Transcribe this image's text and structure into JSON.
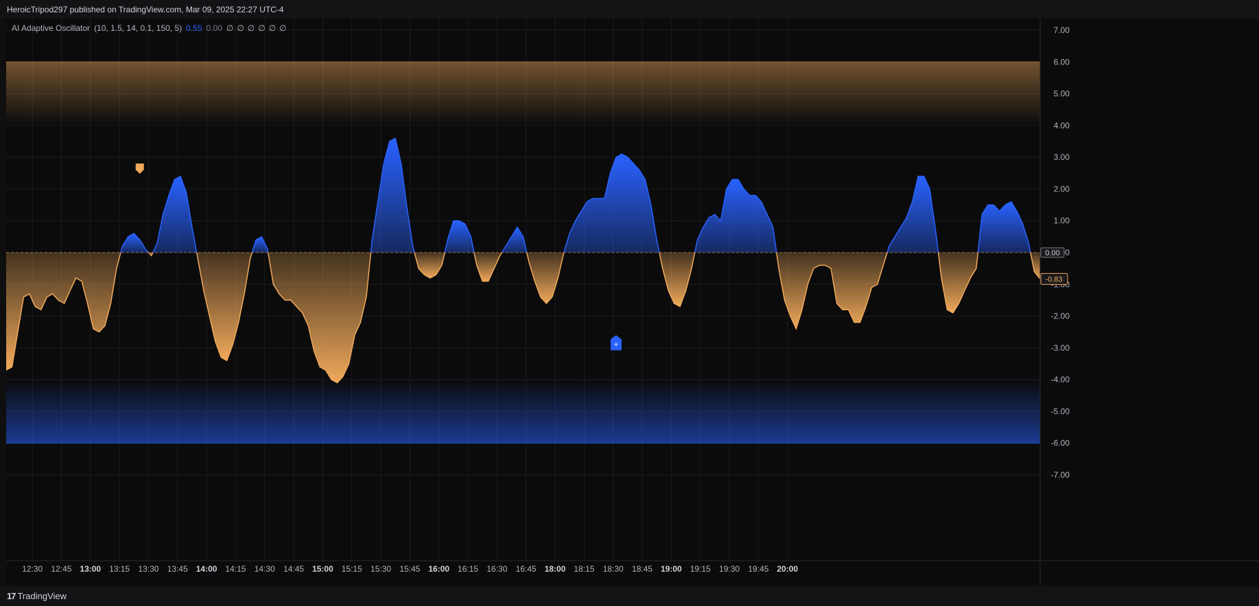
{
  "header": {
    "publisher": "HeroicTripod297 published on TradingView.com, Mar 09, 2025 22:27 UTC-4"
  },
  "legend": {
    "indicator": "AI Adaptive Oscillator",
    "params": "(10, 1.5, 14, 0.1, 150, 5)",
    "value_main": "0.55",
    "value_zero": "0.00",
    "empties": [
      "∅",
      "∅",
      "∅",
      "∅",
      "∅",
      "∅"
    ]
  },
  "footer": {
    "brand_mark": "17",
    "brand_name": "TradingView"
  },
  "colors": {
    "bull": "#2962ff",
    "bear": "#f0a95a",
    "bg": "#0b0b0c",
    "grid": "#1c1c1f",
    "text": "#b2b5be"
  },
  "chart_data": {
    "type": "area",
    "title": "",
    "ylim": [
      -7.0,
      7.0
    ],
    "yticks": [
      "7.00",
      "6.00",
      "5.00",
      "4.00",
      "3.00",
      "2.00",
      "1.00",
      "0.00",
      "-1.00",
      "-2.00",
      "-3.00",
      "-4.00",
      "-5.00",
      "-6.00",
      "-7.00"
    ],
    "ytick_values": [
      7,
      6,
      5,
      4,
      3,
      2,
      1,
      0,
      -1,
      -2,
      -3,
      -4,
      -5,
      -6,
      -7
    ],
    "xtick_labels": [
      "12:30",
      "12:45",
      "13:00",
      "13:15",
      "13:30",
      "13:45",
      "14:00",
      "14:15",
      "14:30",
      "14:45",
      "15:00",
      "15:15",
      "15:30",
      "15:45",
      "16:00",
      "16:15",
      "16:30",
      "16:45",
      "18:00",
      "18:15",
      "18:30",
      "18:45",
      "19:00",
      "19:15",
      "19:30",
      "19:45",
      "20:00"
    ],
    "xtick_bold": [
      "13:00",
      "14:00",
      "15:00",
      "16:00",
      "18:00",
      "19:00",
      "20:00"
    ],
    "xtick_index": [
      4.5,
      9.5,
      14.5,
      19.5,
      24.5,
      29.5,
      34.5,
      39.5,
      44.5,
      49.5,
      54.5,
      59.5,
      64.5,
      69.5,
      74.5,
      79.5,
      84.5,
      89.5,
      94.5,
      99.5,
      104.5,
      109.5,
      114.5,
      119.5,
      124.5,
      129.5,
      134.5
    ],
    "overbought_band": [
      4.0,
      6.0
    ],
    "oversold_band": [
      -6.0,
      -4.0
    ],
    "zero_line": 0.0,
    "last_value_label": "0.00",
    "current_value_label": "-0.83",
    "signals": [
      {
        "kind": "bear-marker",
        "index": 23,
        "value": 2.5
      },
      {
        "kind": "bull-marker",
        "index": 105,
        "value": -2.6,
        "symbol": "+"
      }
    ],
    "series": [
      {
        "values": [
          -3.7,
          -3.6,
          -2.5,
          -1.4,
          -1.3,
          -1.7,
          -1.8,
          -1.4,
          -1.3,
          -1.5,
          -1.6,
          -1.2,
          -0.8,
          -0.9,
          -1.6,
          -2.4,
          -2.5,
          -2.3,
          -1.6,
          -0.5,
          0.2,
          0.5,
          0.6,
          0.4,
          0.1,
          -0.1,
          0.3,
          1.2,
          1.8,
          2.3,
          2.4,
          1.9,
          0.8,
          -0.2,
          -1.2,
          -2.0,
          -2.8,
          -3.3,
          -3.4,
          -2.9,
          -2.2,
          -1.3,
          -0.2,
          0.4,
          0.5,
          0.1,
          -1.0,
          -1.3,
          -1.5,
          -1.5,
          -1.7,
          -1.9,
          -2.3,
          -3.1,
          -3.6,
          -3.7,
          -4.0,
          -4.1,
          -3.9,
          -3.5,
          -2.6,
          -2.2,
          -1.4,
          0.4,
          1.6,
          2.8,
          3.5,
          3.6,
          2.8,
          1.4,
          0.2,
          -0.5,
          -0.7,
          -0.8,
          -0.7,
          -0.4,
          0.4,
          1.0,
          1.0,
          0.9,
          0.5,
          -0.4,
          -0.9,
          -0.9,
          -0.5,
          -0.1,
          0.2,
          0.5,
          0.8,
          0.5,
          -0.3,
          -0.9,
          -1.4,
          -1.6,
          -1.4,
          -0.8,
          0.0,
          0.6,
          1.0,
          1.3,
          1.6,
          1.7,
          1.7,
          1.7,
          2.5,
          3.0,
          3.1,
          3.0,
          2.8,
          2.6,
          2.3,
          1.5,
          0.4,
          -0.5,
          -1.2,
          -1.6,
          -1.7,
          -1.2,
          -0.5,
          0.4,
          0.8,
          1.1,
          1.2,
          1.0,
          2.0,
          2.3,
          2.3,
          2.0,
          1.8,
          1.8,
          1.6,
          1.2,
          0.8,
          -0.5,
          -1.5,
          -2.0,
          -2.4,
          -1.8,
          -1.0,
          -0.5,
          -0.4,
          -0.4,
          -0.5,
          -1.6,
          -1.8,
          -1.8,
          -2.2,
          -2.2,
          -1.7,
          -1.1,
          -1.0,
          -0.4,
          0.2,
          0.5,
          0.8,
          1.1,
          1.6,
          2.4,
          2.4,
          2.0,
          0.7,
          -0.8,
          -1.8,
          -1.9,
          -1.6,
          -1.2,
          -0.8,
          -0.5,
          1.2,
          1.5,
          1.5,
          1.3,
          1.5,
          1.6,
          1.3,
          0.9,
          0.3,
          -0.6,
          -0.83
        ]
      }
    ]
  }
}
